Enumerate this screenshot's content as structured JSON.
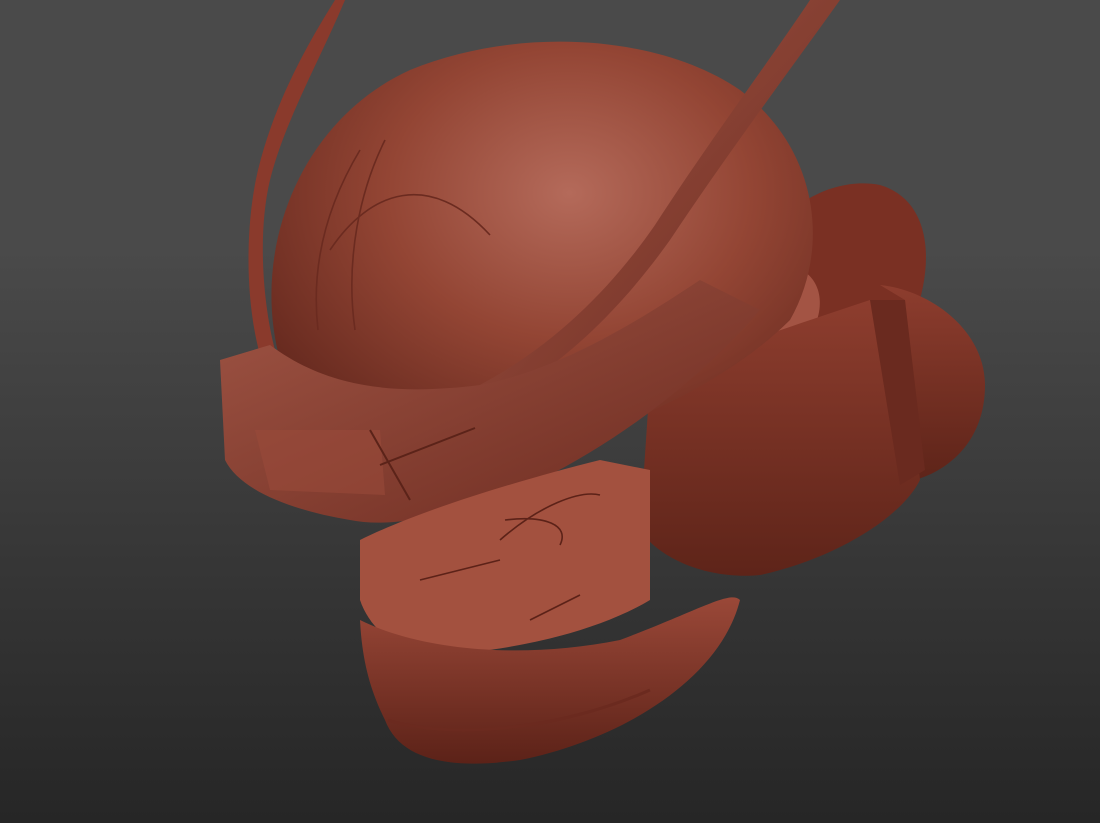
{
  "app": {
    "view": "3d-sculpt-viewport"
  },
  "viewport": {
    "background_top": "#4a4a4a",
    "background_bottom": "#262626",
    "model": {
      "subject": "helmet-sculpt",
      "material_color": "#8f3f30",
      "material_highlight": "#b46a5a",
      "material_shadow": "#5a2219"
    }
  }
}
